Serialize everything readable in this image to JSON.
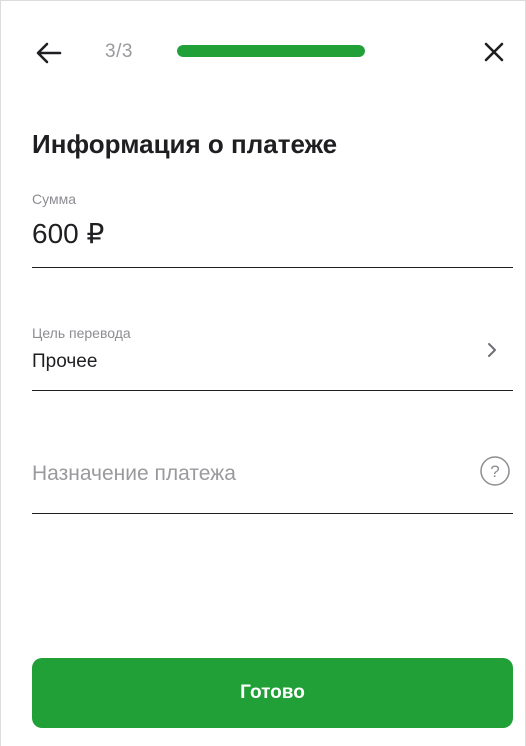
{
  "header": {
    "step_label": "3/3",
    "progress": 1.0,
    "back_icon": "arrow-left-icon",
    "close_icon": "close-icon"
  },
  "title": "Информация о платеже",
  "amount": {
    "label": "Сумма",
    "value": "600 ₽"
  },
  "purpose": {
    "label": "Цель перевода",
    "value": "Прочее",
    "icon": "chevron-right-icon"
  },
  "description": {
    "placeholder": "Назначение платежа",
    "value": "",
    "help_icon": "question-circle-icon"
  },
  "submit": {
    "label": "Готово"
  },
  "colors": {
    "accent": "#21a038",
    "text": "#1f1f22",
    "muted": "#8d8d92"
  }
}
